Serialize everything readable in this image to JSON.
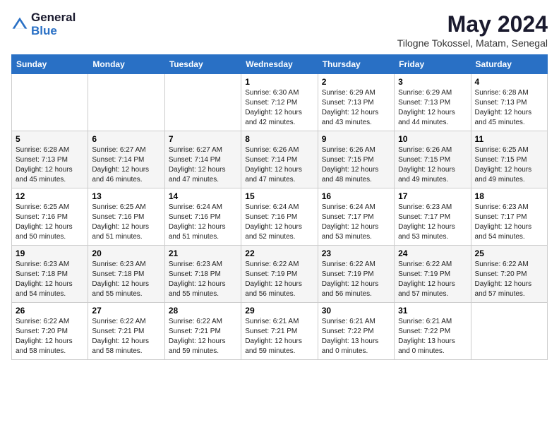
{
  "header": {
    "logo_general": "General",
    "logo_blue": "Blue",
    "month_year": "May 2024",
    "location": "Tilogne Tokossel, Matam, Senegal"
  },
  "days_of_week": [
    "Sunday",
    "Monday",
    "Tuesday",
    "Wednesday",
    "Thursday",
    "Friday",
    "Saturday"
  ],
  "weeks": [
    [
      {
        "day": "",
        "info": ""
      },
      {
        "day": "",
        "info": ""
      },
      {
        "day": "",
        "info": ""
      },
      {
        "day": "1",
        "info": "Sunrise: 6:30 AM\nSunset: 7:12 PM\nDaylight: 12 hours\nand 42 minutes."
      },
      {
        "day": "2",
        "info": "Sunrise: 6:29 AM\nSunset: 7:13 PM\nDaylight: 12 hours\nand 43 minutes."
      },
      {
        "day": "3",
        "info": "Sunrise: 6:29 AM\nSunset: 7:13 PM\nDaylight: 12 hours\nand 44 minutes."
      },
      {
        "day": "4",
        "info": "Sunrise: 6:28 AM\nSunset: 7:13 PM\nDaylight: 12 hours\nand 45 minutes."
      }
    ],
    [
      {
        "day": "5",
        "info": "Sunrise: 6:28 AM\nSunset: 7:13 PM\nDaylight: 12 hours\nand 45 minutes."
      },
      {
        "day": "6",
        "info": "Sunrise: 6:27 AM\nSunset: 7:14 PM\nDaylight: 12 hours\nand 46 minutes."
      },
      {
        "day": "7",
        "info": "Sunrise: 6:27 AM\nSunset: 7:14 PM\nDaylight: 12 hours\nand 47 minutes."
      },
      {
        "day": "8",
        "info": "Sunrise: 6:26 AM\nSunset: 7:14 PM\nDaylight: 12 hours\nand 47 minutes."
      },
      {
        "day": "9",
        "info": "Sunrise: 6:26 AM\nSunset: 7:15 PM\nDaylight: 12 hours\nand 48 minutes."
      },
      {
        "day": "10",
        "info": "Sunrise: 6:26 AM\nSunset: 7:15 PM\nDaylight: 12 hours\nand 49 minutes."
      },
      {
        "day": "11",
        "info": "Sunrise: 6:25 AM\nSunset: 7:15 PM\nDaylight: 12 hours\nand 49 minutes."
      }
    ],
    [
      {
        "day": "12",
        "info": "Sunrise: 6:25 AM\nSunset: 7:16 PM\nDaylight: 12 hours\nand 50 minutes."
      },
      {
        "day": "13",
        "info": "Sunrise: 6:25 AM\nSunset: 7:16 PM\nDaylight: 12 hours\nand 51 minutes."
      },
      {
        "day": "14",
        "info": "Sunrise: 6:24 AM\nSunset: 7:16 PM\nDaylight: 12 hours\nand 51 minutes."
      },
      {
        "day": "15",
        "info": "Sunrise: 6:24 AM\nSunset: 7:16 PM\nDaylight: 12 hours\nand 52 minutes."
      },
      {
        "day": "16",
        "info": "Sunrise: 6:24 AM\nSunset: 7:17 PM\nDaylight: 12 hours\nand 53 minutes."
      },
      {
        "day": "17",
        "info": "Sunrise: 6:23 AM\nSunset: 7:17 PM\nDaylight: 12 hours\nand 53 minutes."
      },
      {
        "day": "18",
        "info": "Sunrise: 6:23 AM\nSunset: 7:17 PM\nDaylight: 12 hours\nand 54 minutes."
      }
    ],
    [
      {
        "day": "19",
        "info": "Sunrise: 6:23 AM\nSunset: 7:18 PM\nDaylight: 12 hours\nand 54 minutes."
      },
      {
        "day": "20",
        "info": "Sunrise: 6:23 AM\nSunset: 7:18 PM\nDaylight: 12 hours\nand 55 minutes."
      },
      {
        "day": "21",
        "info": "Sunrise: 6:23 AM\nSunset: 7:18 PM\nDaylight: 12 hours\nand 55 minutes."
      },
      {
        "day": "22",
        "info": "Sunrise: 6:22 AM\nSunset: 7:19 PM\nDaylight: 12 hours\nand 56 minutes."
      },
      {
        "day": "23",
        "info": "Sunrise: 6:22 AM\nSunset: 7:19 PM\nDaylight: 12 hours\nand 56 minutes."
      },
      {
        "day": "24",
        "info": "Sunrise: 6:22 AM\nSunset: 7:19 PM\nDaylight: 12 hours\nand 57 minutes."
      },
      {
        "day": "25",
        "info": "Sunrise: 6:22 AM\nSunset: 7:20 PM\nDaylight: 12 hours\nand 57 minutes."
      }
    ],
    [
      {
        "day": "26",
        "info": "Sunrise: 6:22 AM\nSunset: 7:20 PM\nDaylight: 12 hours\nand 58 minutes."
      },
      {
        "day": "27",
        "info": "Sunrise: 6:22 AM\nSunset: 7:21 PM\nDaylight: 12 hours\nand 58 minutes."
      },
      {
        "day": "28",
        "info": "Sunrise: 6:22 AM\nSunset: 7:21 PM\nDaylight: 12 hours\nand 59 minutes."
      },
      {
        "day": "29",
        "info": "Sunrise: 6:21 AM\nSunset: 7:21 PM\nDaylight: 12 hours\nand 59 minutes."
      },
      {
        "day": "30",
        "info": "Sunrise: 6:21 AM\nSunset: 7:22 PM\nDaylight: 13 hours\nand 0 minutes."
      },
      {
        "day": "31",
        "info": "Sunrise: 6:21 AM\nSunset: 7:22 PM\nDaylight: 13 hours\nand 0 minutes."
      },
      {
        "day": "",
        "info": ""
      }
    ]
  ]
}
